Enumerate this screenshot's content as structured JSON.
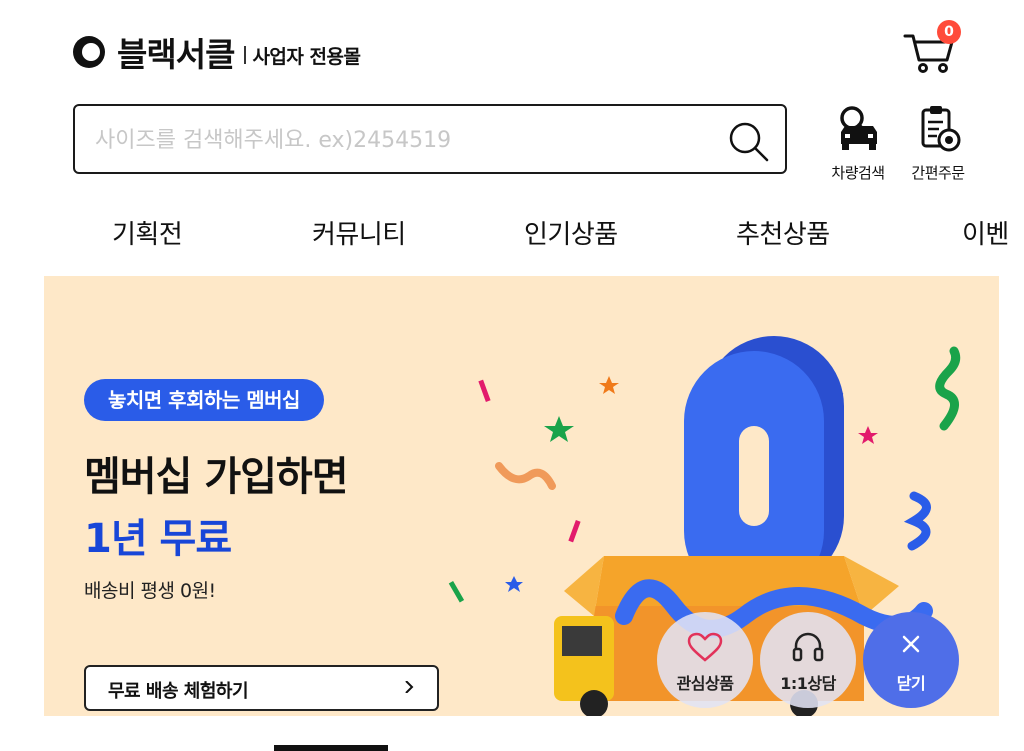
{
  "header": {
    "brand_name": "블랙서클",
    "brand_sub": "사업자 전용몰",
    "cart_count": "0"
  },
  "search": {
    "placeholder": "사이즈를 검색해주세요. ex)2454519"
  },
  "quick_links": {
    "vehicle_search": "차량검색",
    "easy_order": "간편주문"
  },
  "nav": {
    "items": [
      "기획전",
      "커뮤니티",
      "인기상품",
      "추천상품",
      "이벤"
    ]
  },
  "banner": {
    "pill": "놓치면 후회하는 멤버십",
    "headline": "멤버십 가입하면",
    "headline_highlight": "1년 무료",
    "subtext": "배송비 평생 0원!",
    "cta": "무료 배송 체험하기"
  },
  "floating": {
    "like": "관심상품",
    "chat": "1:1상담",
    "close": "닫기"
  },
  "colors": {
    "accent_blue": "#2a5ce8",
    "banner_bg": "#fee8c8",
    "badge_red": "#ff4b3a",
    "fab_close": "#4f6ee8"
  }
}
